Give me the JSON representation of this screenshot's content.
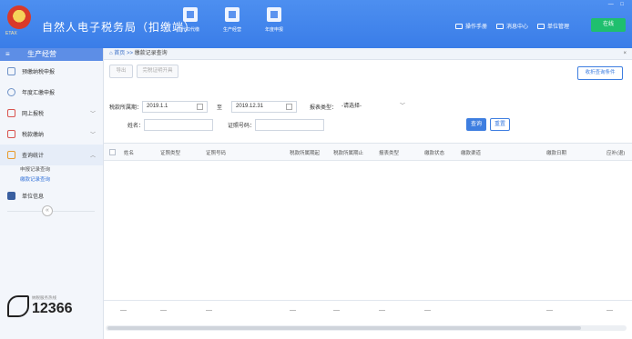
{
  "app": {
    "title": "自然人电子税务局（扣缴端）",
    "logo_caption": "ETAX",
    "window_controls": "— □",
    "top_tools": [
      {
        "label": "代扣代缴",
        "icon": "building-icon"
      },
      {
        "label": "生产经营",
        "icon": "factory-icon"
      },
      {
        "label": "年度申报",
        "icon": "calendar-icon"
      }
    ],
    "top_links": [
      "操作手册",
      "消息中心",
      "单位管理"
    ],
    "online_label": "在线"
  },
  "sidebar": {
    "header": "生产经营",
    "items": [
      {
        "label": "预缴纳税申报",
        "icon": "form-icon"
      },
      {
        "label": "年度汇缴申报",
        "icon": "clock-icon"
      },
      {
        "label": "网上报税",
        "icon": "send-icon",
        "chevron": "﹀"
      },
      {
        "label": "税款缴纳",
        "icon": "money-icon",
        "chevron": "﹀"
      },
      {
        "label": "查询统计",
        "icon": "chart-icon",
        "chevron": "︿"
      }
    ],
    "sub_items": [
      "申报记录查询",
      "缴款记录查询"
    ],
    "last_item": {
      "label": "单位信息",
      "icon": "grid-icon"
    },
    "collapse_symbol": "«",
    "hotline_caption": "纳税服务热线",
    "hotline": "12366"
  },
  "main": {
    "breadcrumb_home": "首页",
    "breadcrumb_sep": ">>",
    "breadcrumb_current": "缴款记录查询",
    "close_symbol": "×",
    "toolbar": {
      "export_label": "导出",
      "print_label": "完税证明开具",
      "fold_label": "收折查询条件"
    },
    "filters": {
      "period_label": "税款所属期：",
      "period_from": "2019.1.1",
      "to_label": "至",
      "period_to": "2019.12.31",
      "report_type_label": "报表类型：",
      "report_type_value": "-请选择-",
      "name_label": "姓名：",
      "id_label": "证照号码：",
      "query_label": "查询",
      "reset_label": "重置"
    },
    "table": {
      "columns": [
        "姓名",
        "证照类型",
        "证照号码",
        "税款所属期起",
        "税款所属期止",
        "报表类型",
        "缴款状态",
        "缴款渠道",
        "缴款日期",
        "应补(退)"
      ],
      "empty_mark": "—"
    }
  },
  "colors": {
    "titlebar": "#3a7de8",
    "accent": "#3e7ee0",
    "online": "#1fbf6e",
    "reset_border": "#3e7ee0"
  }
}
